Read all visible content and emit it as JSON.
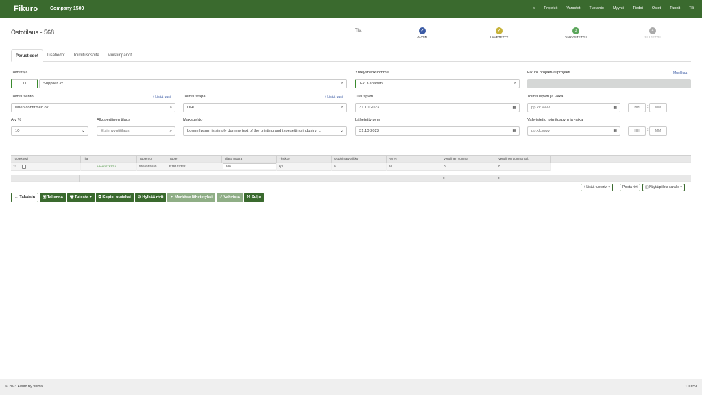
{
  "topbar": {
    "brand": "Fikuro",
    "company": "Company 1500",
    "nav": [
      "Projektit",
      "Varastot",
      "Tuotanto",
      "Myynti",
      "Tiedot",
      "Ostot",
      "Tunnit",
      "Tili"
    ]
  },
  "page": {
    "title": "Ostotilaus - 568",
    "tila_label": "Tila"
  },
  "progress": {
    "steps": [
      {
        "label": "AVOIN",
        "mark": "✔",
        "color": "#3b5ba5"
      },
      {
        "label": "LÄHETETTY",
        "mark": "✔",
        "color": "#c7b33a"
      },
      {
        "label": "VAHVISTETTU",
        "mark": "3",
        "color": "#5aa55a"
      },
      {
        "label": "SULJETTU",
        "mark": "4",
        "color": "#aaaaaa"
      }
    ]
  },
  "tabs": [
    "Perustiedot",
    "Lisätiedot",
    "Toimitusosoite",
    "Muistiinpanot"
  ],
  "form": {
    "supplier_label": "Toimittaja",
    "supplier_code": "11",
    "supplier_name": "Supplier 3x",
    "contact_label": "Yhteyshenkilömme",
    "contact_value": "Eki Kananen",
    "project_label": "Fikuro projekti/aliprojekti",
    "project_link": "Muokkaa",
    "terms_label": "Toimitusehto",
    "terms_add": "+ Lisää uusi",
    "terms_value": "when confirmed ok",
    "method_label": "Toimitustapa",
    "method_add": "+ Lisää uusi",
    "method_value": "DHL",
    "orderdate_label": "Tilauspvm",
    "orderdate_value": "31.10.2023",
    "deliverydate_label": "Toimituspvm ja -aika",
    "deliverydate_placeholder": "pp.kk.vvvv",
    "hh": "HH",
    "mm": "MM",
    "vat_label": "Alv %",
    "vat_value": "10",
    "origorder_label": "Alkuperäinen tilaus",
    "origorder_placeholder": "Etsi myyntitilaus",
    "payment_label": "Maksuehto",
    "payment_value": "Lorem Ipsum is simply dummy text of the printing and typesetting industry. L",
    "sentdate_label": "Lähetetty pvm",
    "sentdate_value": "31.10.2023",
    "confdate_label": "Vahvistettu toimituspvm ja -aika",
    "confdate_placeholder": "pp.kk.vvvv"
  },
  "table": {
    "headers": [
      "Tuotekoodi",
      "Tila",
      "Tuotenro",
      "Tuote",
      "Tilattu määrä",
      "Yksikkö",
      "Ostohinta/yksikkö",
      "Alv %",
      "Verollinen summa",
      "Verollinen summa val."
    ],
    "row": {
      "code": "25",
      "status": "VAHVISTETTU",
      "productno": "5555555555...",
      "product": "P16102322",
      "qty": "100",
      "unit": "kpl",
      "price": "0",
      "vat": "10",
      "sum": "0",
      "sum_cur": "0"
    },
    "footer": {
      "sum": "0",
      "sum_cur": "0"
    },
    "buttons": {
      "add_row": "+ Lisää tuoterivi ▾",
      "delete_row": "Poista rivi",
      "toggle_col": "◫ Näytä/piilota sarake ▾"
    }
  },
  "actions": {
    "back": "← Takaisin",
    "save": "🖫 Tallenna",
    "print": "🖶 Tulosta ▾",
    "copy": "⧉ Kopioi uudeksi",
    "reject": "⊘ Hylkää rivit",
    "mark_sent": "➤ Merkitse lähetetyksi",
    "confirm": "✔ Vahvista",
    "close": "⚒ Sulje"
  },
  "footer": {
    "copyright": "© 2023 Fikuro By Visma",
    "version": "1.0.659"
  }
}
